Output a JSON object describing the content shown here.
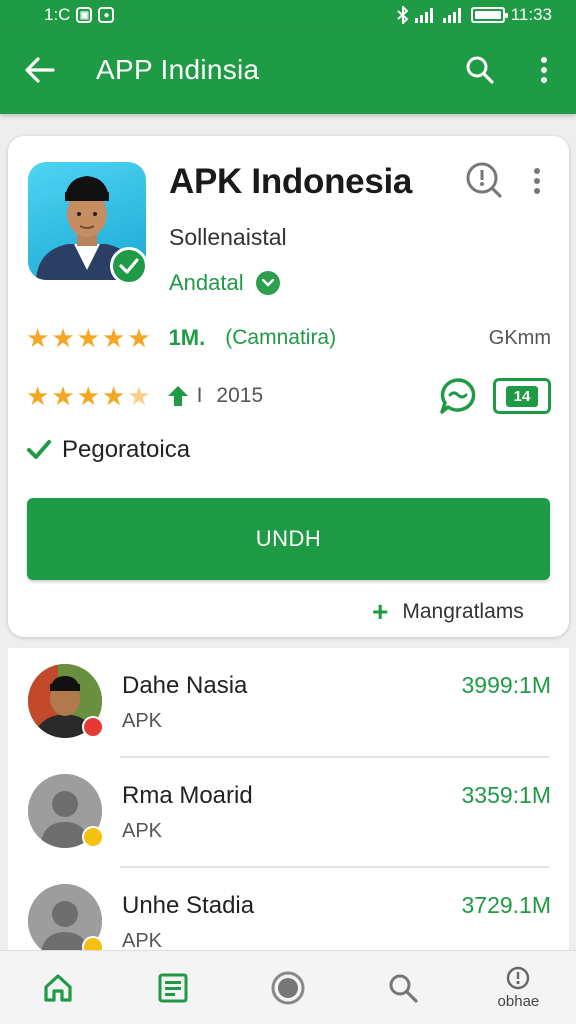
{
  "status_bar": {
    "time_left": "1:C",
    "time_right": "11:33"
  },
  "app_bar": {
    "title": "APP Indinsia"
  },
  "app": {
    "name": "APK Indonesia",
    "developer": "Sollenaistal",
    "category": "Andatal",
    "rating_count": "1M.",
    "rating_desc": "(Camnatira)",
    "size": "GKmm",
    "year_prefix": "I",
    "year": "2015",
    "rating_badge": "14",
    "feature": "Pegoratoica",
    "install_label": "UNDH",
    "more_label": "Mangratlams"
  },
  "list": [
    {
      "name": "Dahe Nasia",
      "type": "APK",
      "size": "3999:1M",
      "avatar": "photo",
      "badge_color": "#e53935"
    },
    {
      "name": "Rma Moarid",
      "type": "APK",
      "size": "3359:1M",
      "avatar": "placeholder",
      "badge_color": "#f4c20d"
    },
    {
      "name": "Unhe Stadia",
      "type": "APK",
      "size": "3729.1M",
      "avatar": "placeholder",
      "badge_color": "#f4c20d"
    }
  ],
  "bottom_nav": {
    "items": [
      {
        "icon": "home-icon",
        "label": ""
      },
      {
        "icon": "news-icon",
        "label": ""
      },
      {
        "icon": "record-icon",
        "label": ""
      },
      {
        "icon": "search-icon",
        "label": ""
      },
      {
        "icon": "info-icon",
        "label": "obhae"
      }
    ]
  },
  "colors": {
    "accent": "#1f9a45",
    "star": "#f5a623"
  }
}
